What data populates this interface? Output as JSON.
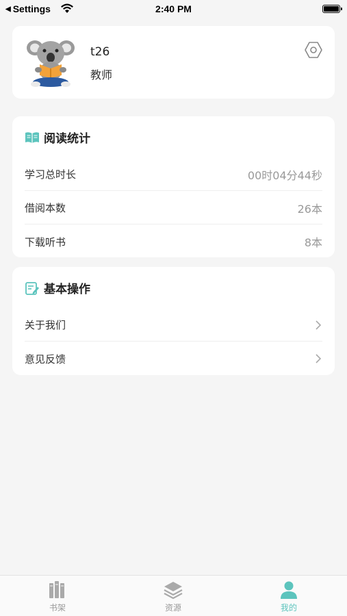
{
  "status_bar": {
    "back_label": "Settings",
    "time": "2:40 PM"
  },
  "profile": {
    "name": "t26",
    "role": "教师"
  },
  "reading_stats": {
    "title": "阅读统计",
    "rows": [
      {
        "label": "学习总时长",
        "value": "00时04分44秒"
      },
      {
        "label": "借阅本数",
        "value": "26本"
      },
      {
        "label": "下载听书",
        "value": "8本"
      }
    ]
  },
  "basic_ops": {
    "title": "基本操作",
    "items": [
      {
        "label": "关于我们"
      },
      {
        "label": "意见反馈"
      }
    ]
  },
  "tabbar": {
    "tabs": [
      {
        "label": "书架",
        "icon": "bookshelf-icon"
      },
      {
        "label": "资源",
        "icon": "layers-icon"
      },
      {
        "label": "我的",
        "icon": "person-icon",
        "active": true
      }
    ]
  },
  "colors": {
    "accent": "#5cc4bd",
    "background": "#f5f5f5",
    "card": "#ffffff"
  }
}
